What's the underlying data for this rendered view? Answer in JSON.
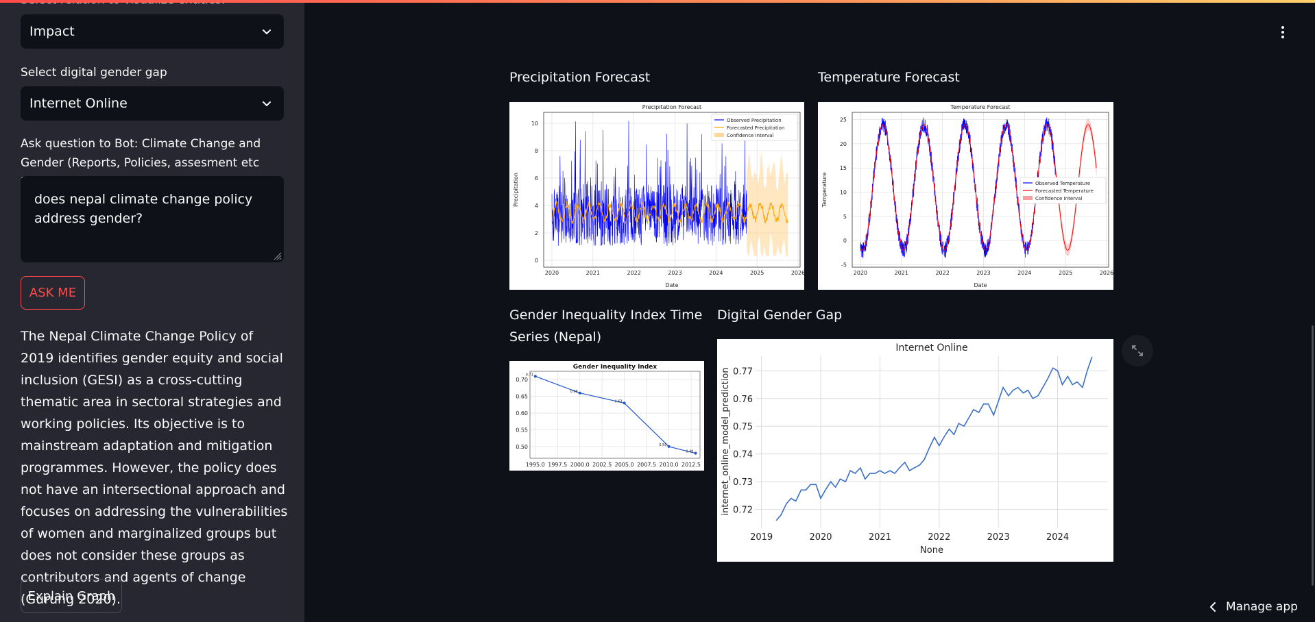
{
  "sidebar": {
    "cut_label": "Select relation to visualize entities:",
    "relation_select": {
      "value": "Impact"
    },
    "gap_label": "Select digital gender gap",
    "gap_select": {
      "value": "Internet Online"
    },
    "question_label": "Ask question to Bot: Climate Change and Gender (Reports, Policies, assesment etc Nepal)",
    "question_value": "does nepal climate change policy address gender?",
    "ask_button": "ASK ME",
    "answer": "The Nepal Climate Change Policy of 2019 identifies gender equity and social inclusion (GESI) as a cross-cutting thematic area in sectoral strategies and working policies. Its objective is to mainstream adaptation and mitigation programmes. However, the policy does not have an intersectional approach and focuses on addressing the vulnerabilities of women and marginalized groups but does not consider these groups as contributors and agents of change (Gurung 2020).",
    "explain_button": "Explain Graph"
  },
  "main": {
    "precip_title": "Precipitation Forecast",
    "temp_title": "Temperature Forecast",
    "gii_title": "Gender Inequality Index Time Series (Nepal)",
    "dgg_title": "Digital Gender Gap",
    "manage_app": "Manage app"
  },
  "colors": {
    "accent": "#ff4b4b",
    "observed": "#0000ff",
    "forecast_precip": "#ffa500",
    "forecast_temp": "#ff0000",
    "line": "#3a6fc4"
  },
  "chart_data": [
    {
      "type": "line",
      "title": "Precipitation Forecast",
      "xlabel": "Date",
      "ylabel": "Precipitation",
      "x_ticks": [
        "2020",
        "2021",
        "2022",
        "2023",
        "2024",
        "2025",
        "2026"
      ],
      "y_ticks": [
        0,
        2,
        4,
        6,
        8,
        10
      ],
      "xlim": [
        2019.8,
        2026.05
      ],
      "ylim": [
        -0.5,
        10.8
      ],
      "series": [
        {
          "name": "Observed Precipitation",
          "x_range": [
            2020.0,
            2024.75
          ],
          "approx_mean": 3.4,
          "approx_range": [
            0.5,
            10.2
          ]
        },
        {
          "name": "Forecasted Precipitation",
          "x_range": [
            2020.0,
            2025.75
          ],
          "approx_mean": 3.5,
          "approx_range": [
            2.3,
            4.6
          ]
        },
        {
          "name": "Confidence Interval",
          "x_range": [
            2024.75,
            2025.75
          ],
          "approx_range": [
            0.5,
            6.5
          ]
        }
      ],
      "legend": "top-right"
    },
    {
      "type": "line",
      "title": "Temperature Forecast",
      "xlabel": "Date",
      "ylabel": "Temperature",
      "x_ticks": [
        "2020",
        "2021",
        "2022",
        "2023",
        "2024",
        "2025",
        "2026"
      ],
      "y_ticks": [
        -5,
        0,
        5,
        10,
        15,
        20,
        25
      ],
      "xlim": [
        2019.8,
        2026.05
      ],
      "ylim": [
        -5.5,
        26.5
      ],
      "series": [
        {
          "name": "Observed Temperature",
          "x_range": [
            2020.0,
            2024.75
          ],
          "approx_range": [
            -2,
            24
          ]
        },
        {
          "name": "Forecasted Temperature",
          "x_range": [
            2020.0,
            2025.75
          ],
          "approx_range": [
            -2,
            24
          ]
        },
        {
          "name": "Confidence Interval",
          "x_range": [
            2024.75,
            2025.75
          ]
        }
      ],
      "legend": "center-right"
    },
    {
      "type": "line",
      "title": "Gender Inequality Index",
      "x": [
        1995,
        2000,
        2005,
        2010,
        2013
      ],
      "y": [
        0.71,
        0.66,
        0.63,
        0.5,
        0.48
      ],
      "point_labels": [
        "0.71",
        "0.66",
        "0.63",
        "0.50",
        "0.48"
      ],
      "x_ticks": [
        "1995.0",
        "1997.5",
        "2000.0",
        "2002.5",
        "2005.0",
        "2007.5",
        "2010.0",
        "2012.5"
      ],
      "y_ticks": [
        "0.70",
        "0.65",
        "0.60",
        "0.55",
        "0.50"
      ],
      "xlim": [
        1994.4,
        2013.5
      ],
      "ylim": [
        0.465,
        0.725
      ]
    },
    {
      "type": "line",
      "title": "Internet Online",
      "xlabel": "None",
      "ylabel": "internet_online_model_prediction",
      "x_ticks": [
        "2019",
        "2020",
        "2021",
        "2022",
        "2023",
        "2024"
      ],
      "y_ticks": [
        "0.72",
        "0.73",
        "0.74",
        "0.75",
        "0.76",
        "0.77"
      ],
      "xlim": [
        2018.9,
        2024.85
      ],
      "ylim": [
        0.7135,
        0.7755
      ],
      "series": [
        {
          "name": "internet_online_model_prediction",
          "x": [
            2019.25,
            2019.33,
            2019.42,
            2019.5,
            2019.58,
            2019.67,
            2019.75,
            2019.83,
            2019.92,
            2020.0,
            2020.08,
            2020.17,
            2020.25,
            2020.33,
            2020.42,
            2020.5,
            2020.58,
            2020.67,
            2020.75,
            2020.83,
            2020.92,
            2021.0,
            2021.08,
            2021.17,
            2021.25,
            2021.33,
            2021.42,
            2021.5,
            2021.58,
            2021.67,
            2021.75,
            2021.83,
            2021.92,
            2022.0,
            2022.08,
            2022.17,
            2022.25,
            2022.33,
            2022.42,
            2022.5,
            2022.58,
            2022.67,
            2022.75,
            2022.83,
            2022.92,
            2023.0,
            2023.08,
            2023.17,
            2023.25,
            2023.33,
            2023.42,
            2023.5,
            2023.58,
            2023.67,
            2023.75,
            2023.83,
            2023.92,
            2024.0,
            2024.08,
            2024.17,
            2024.25,
            2024.33,
            2024.42,
            2024.5,
            2024.58
          ],
          "values": [
            0.716,
            0.718,
            0.722,
            0.724,
            0.723,
            0.727,
            0.727,
            0.729,
            0.729,
            0.724,
            0.727,
            0.73,
            0.728,
            0.731,
            0.73,
            0.734,
            0.733,
            0.735,
            0.731,
            0.733,
            0.733,
            0.734,
            0.733,
            0.734,
            0.733,
            0.735,
            0.737,
            0.734,
            0.735,
            0.736,
            0.738,
            0.742,
            0.746,
            0.743,
            0.746,
            0.749,
            0.747,
            0.751,
            0.75,
            0.753,
            0.756,
            0.755,
            0.758,
            0.758,
            0.754,
            0.759,
            0.764,
            0.761,
            0.763,
            0.764,
            0.762,
            0.763,
            0.76,
            0.761,
            0.764,
            0.767,
            0.771,
            0.77,
            0.765,
            0.768,
            0.765,
            0.766,
            0.764,
            0.77,
            0.775
          ]
        }
      ]
    }
  ]
}
